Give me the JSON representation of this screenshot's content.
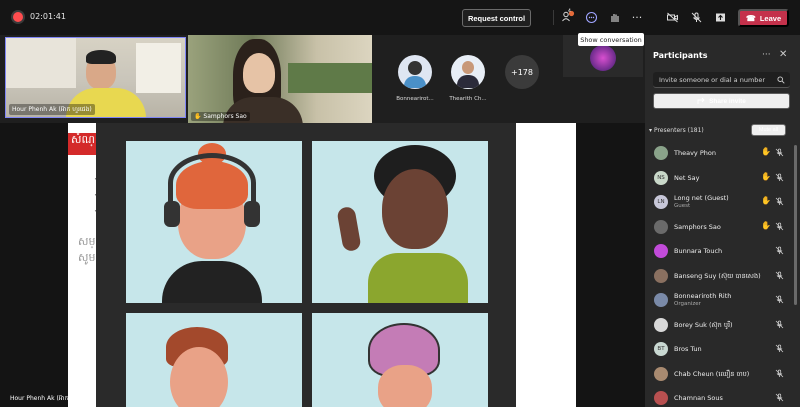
{
  "topbar": {
    "timer": "02:01:41",
    "request_control": "Request control",
    "leave": "Leave",
    "badge_count": "4"
  },
  "tooltip": "Show conversation",
  "tiles": {
    "main_name": "Hour Phenh Ak (អ៊ាក ហួរផេង)",
    "second_name": "Samphors Sao",
    "avatars": [
      {
        "name": "Bonnearirot..."
      },
      {
        "name": "Thearith Ch..."
      }
    ],
    "more_count": "+178"
  },
  "stage": {
    "self_name": "Hour Phenh Ak (អ៊ាក ហួរផេង)",
    "slide_title_fragment": "សំណ្",
    "slide_text_1": "សម្",
    "slide_text_2": "សូម"
  },
  "panel": {
    "title": "Participants",
    "invite_placeholder": "Invite someone or dial a number",
    "share_invite": "Share invite",
    "presenters_label": "Presenters (181)",
    "mute_all": "Mute all",
    "participants": [
      {
        "name": "Theavy Phon",
        "sub": "",
        "initials": "",
        "hand": true,
        "color": "#8aa38a"
      },
      {
        "name": "Net Say",
        "sub": "",
        "initials": "NS",
        "hand": true,
        "color": "#c9d8c9"
      },
      {
        "name": "Long net (Guest)",
        "sub": "Guest",
        "initials": "LN",
        "hand": true,
        "color": "#c7c7d8"
      },
      {
        "name": "Samphors Sao",
        "sub": "",
        "initials": "",
        "hand": true,
        "color": "#6a6a6a"
      },
      {
        "name": "Bunnara Touch",
        "sub": "",
        "initials": "",
        "hand": false,
        "color": "#c24bd9"
      },
      {
        "name": "Banseng Suy (ស៊ុយ បានសេង)",
        "sub": "",
        "initials": "",
        "hand": false,
        "color": "#8a7060"
      },
      {
        "name": "Bonneariroth Rith",
        "sub": "Organizer",
        "initials": "",
        "hand": false,
        "color": "#7a8aa8"
      },
      {
        "name": "Borey Suk (ស៊ុក បូរី)",
        "sub": "",
        "initials": "",
        "hand": false,
        "color": "#d8d8d8"
      },
      {
        "name": "Bros Tun",
        "sub": "",
        "initials": "BT",
        "hand": false,
        "color": "#c9d8d2"
      },
      {
        "name": "Chab Cheun (ឈឿន ចាប)",
        "sub": "",
        "initials": "",
        "hand": false,
        "color": "#a88a70"
      },
      {
        "name": "Chamnan Sous",
        "sub": "",
        "initials": "",
        "hand": false,
        "color": "#b85050"
      }
    ]
  },
  "colors": {
    "accent": "#7f85f5",
    "leave": "#c4314b",
    "raise_hand": "#f7c948"
  }
}
